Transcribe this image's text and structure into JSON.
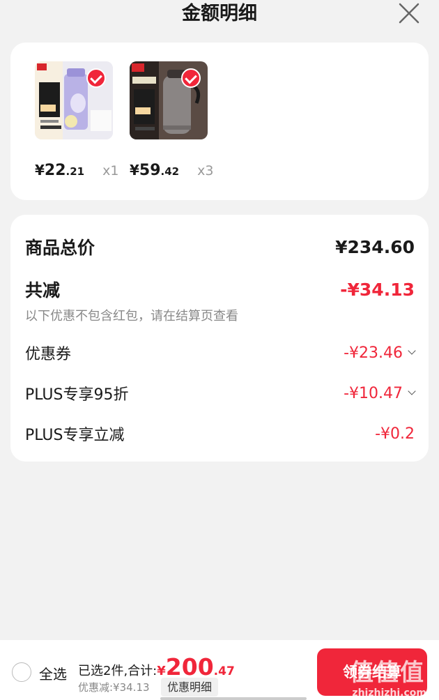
{
  "header": {
    "title": "金额明细"
  },
  "products": [
    {
      "name": "purple-water-bottle",
      "price_symbol": "¥",
      "price_int": "22",
      "price_dec": ".21",
      "quantity": "x1",
      "selected": true
    },
    {
      "name": "thermal-kettle",
      "price_symbol": "¥",
      "price_int": "59",
      "price_dec": ".42",
      "quantity": "x3",
      "selected": true
    }
  ],
  "summary": {
    "total_label": "商品总价",
    "total_value": "¥234.60",
    "reduce_label": "共减",
    "reduce_value": "-¥34.13",
    "note": "以下优惠不包含红包，请在结算页查看",
    "items": [
      {
        "label": "优惠券",
        "value": "-¥23.46",
        "expandable": true
      },
      {
        "label": "PLUS专享95折",
        "value": "-¥10.47",
        "expandable": true
      },
      {
        "label": "PLUS专享立减",
        "value": "-¥0.2",
        "expandable": false
      }
    ]
  },
  "bottom_bar": {
    "select_all_label": "全选",
    "selected_text": "已选2件,合计:",
    "total_symbol": "¥",
    "total_int": "200",
    "total_dec": ".47",
    "discount_text": "优惠减:¥34.13",
    "detail_button": "优惠明细",
    "checkout_button": "领券结算"
  },
  "watermark": {
    "text": "值值值",
    "url": "zhizhizhi.com"
  },
  "colors": {
    "accent": "#f0263a",
    "background": "#f2f2f2"
  }
}
